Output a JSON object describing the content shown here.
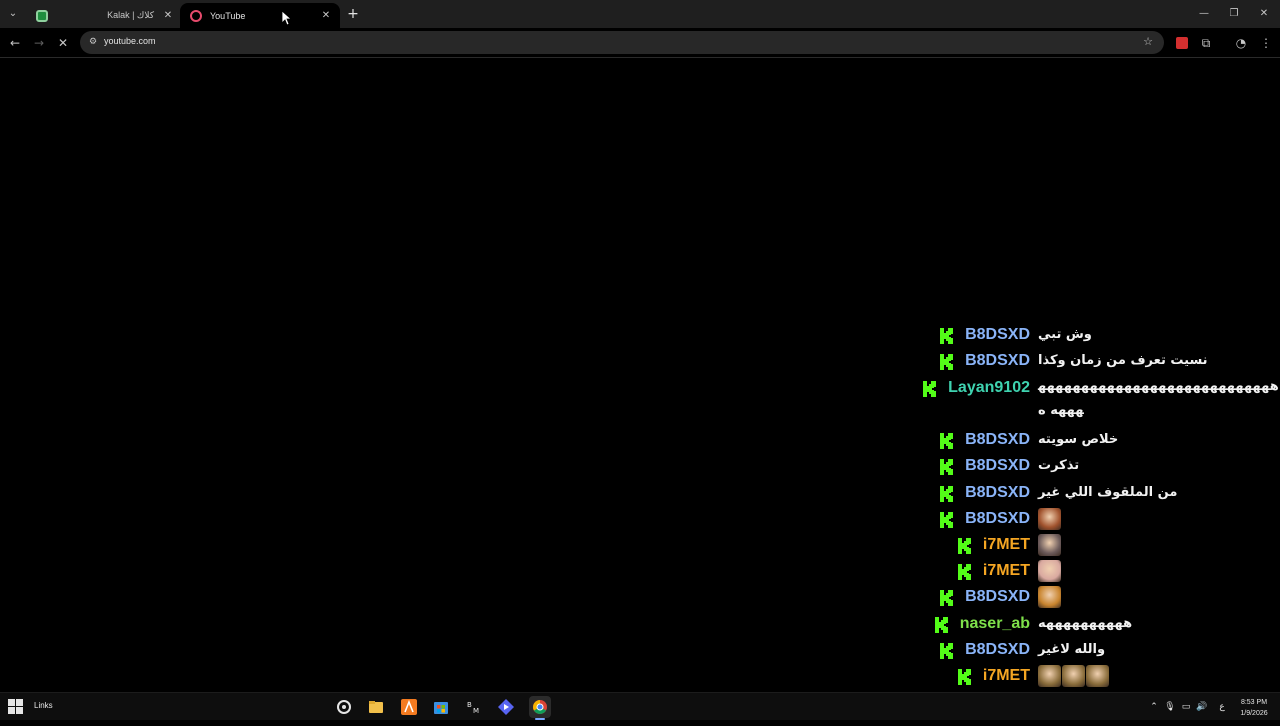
{
  "browser": {
    "tabs": [
      {
        "title": "Kalak | كلاك",
        "icon": "kalak-favicon"
      },
      {
        "title": "YouTube",
        "icon": "youtube-loading-favicon"
      }
    ],
    "url": "youtube.com",
    "colors": {
      "kick_green": "#53fc18"
    }
  },
  "chat": {
    "messages": [
      {
        "user": "B8DSXD",
        "color": "#8ab4f8",
        "text": "وش تبي"
      },
      {
        "user": "B8DSXD",
        "color": "#8ab4f8",
        "text": "نسيت تعرف من زمان وكذا"
      },
      {
        "user": "Layan9102",
        "color": "#3fd3b0",
        "text": "هههههههههههههههههههههههههههههههه ه",
        "wrap": true
      },
      {
        "user": "B8DSXD",
        "color": "#8ab4f8",
        "text": "خلاص سويته"
      },
      {
        "user": "B8DSXD",
        "color": "#8ab4f8",
        "text": "تذكرت"
      },
      {
        "user": "B8DSXD",
        "color": "#8ab4f8",
        "text": "من الملقوف اللي غير"
      },
      {
        "user": "B8DSXD",
        "color": "#8ab4f8",
        "emotes": [
          "#a0522d"
        ]
      },
      {
        "user": "i7MET",
        "color": "#f5a623",
        "emotes": [
          "#6b5a5a"
        ]
      },
      {
        "user": "i7MET",
        "color": "#f5a623",
        "emotes": [
          "#d9a9a0"
        ]
      },
      {
        "user": "B8DSXD",
        "color": "#8ab4f8",
        "emotes": [
          "#c8842e"
        ]
      },
      {
        "user": "naser_ab",
        "color": "#7ee04a",
        "text": "ههههههههههه"
      },
      {
        "user": "B8DSXD",
        "color": "#8ab4f8",
        "text": "والله لاغير"
      },
      {
        "user": "i7MET",
        "color": "#f5a623",
        "emotes": [
          "#8a6d3b",
          "#8a6d3b",
          "#8a6d3b"
        ]
      }
    ]
  },
  "taskbar": {
    "links_label": "Links",
    "apps": [
      "steam-icon",
      "file-explorer-icon",
      "app-orange-icon",
      "microsoft-store-icon",
      "bm-app-icon",
      "diamond-app-icon",
      "chrome-icon"
    ],
    "language": "ع",
    "time": "8:53 PM",
    "date": "1/9/2026"
  }
}
